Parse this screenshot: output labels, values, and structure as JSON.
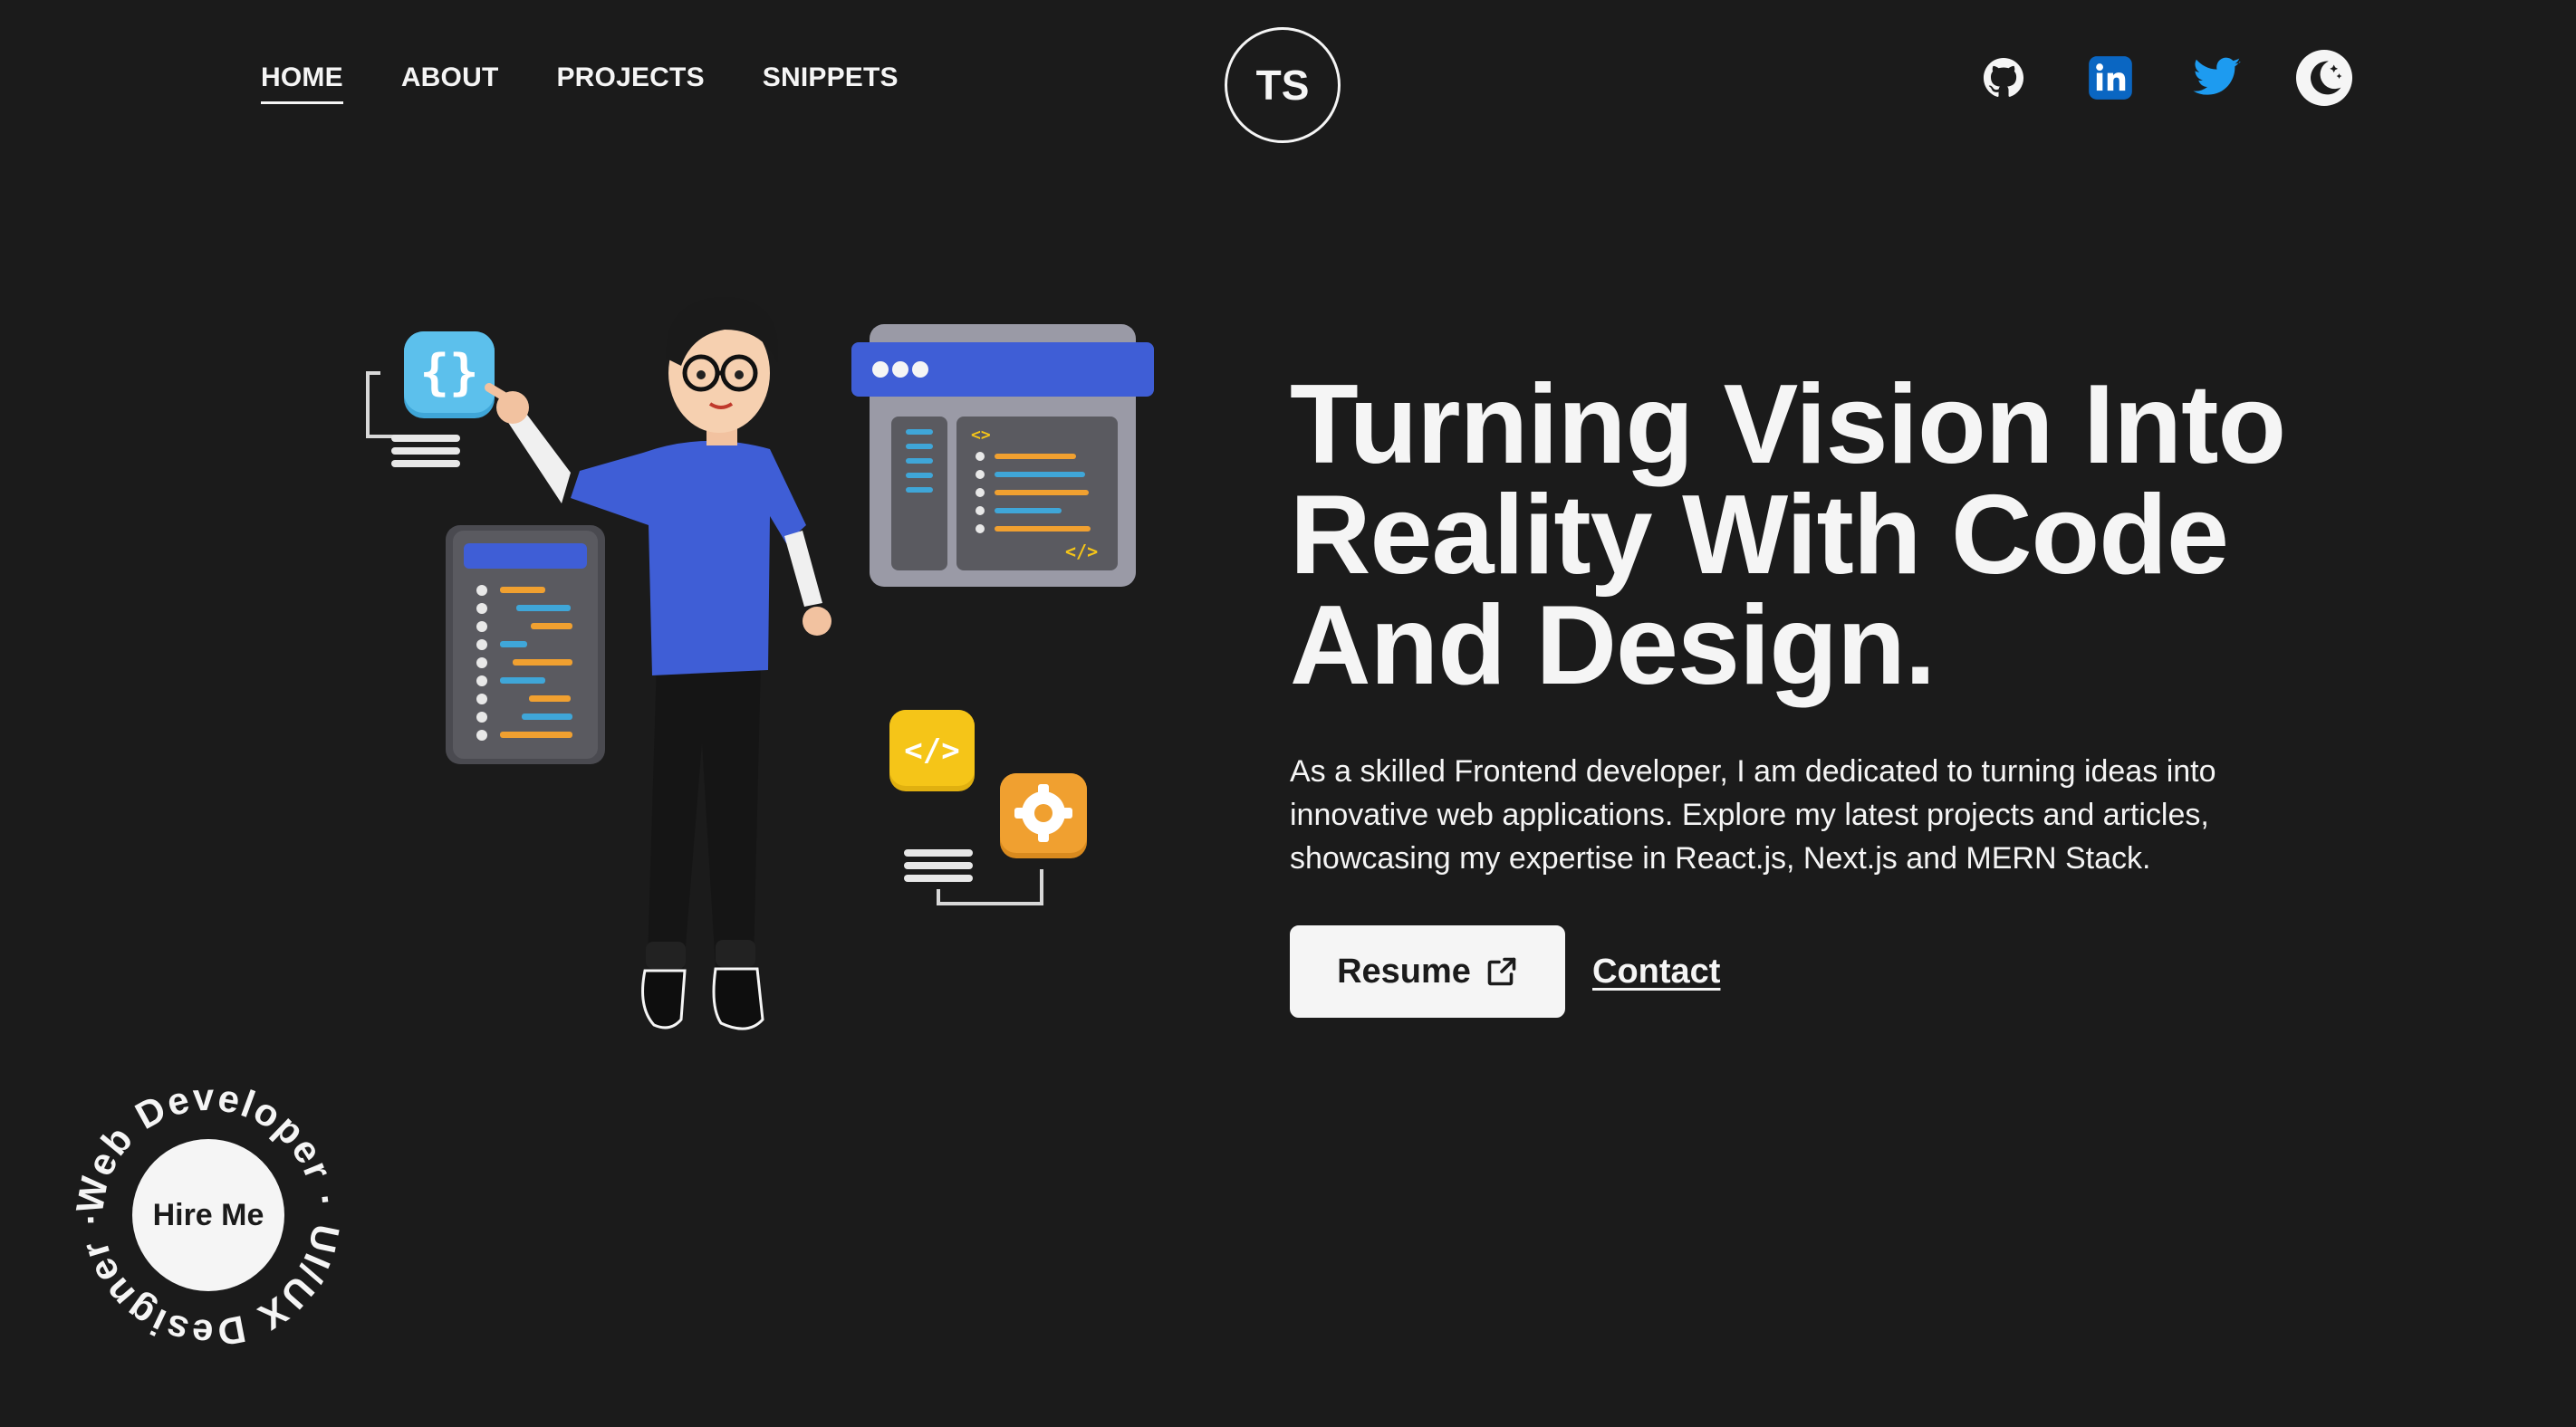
{
  "nav": {
    "links": [
      {
        "label": "HOME",
        "active": true
      },
      {
        "label": "ABOUT",
        "active": false
      },
      {
        "label": "PROJECTS",
        "active": false
      },
      {
        "label": "SNIPPETS",
        "active": false
      }
    ],
    "logo_text": "TS",
    "social": [
      "github-icon",
      "linkedin-icon",
      "twitter-icon",
      "theme-toggle-moon-icon"
    ]
  },
  "hero": {
    "title_lines": [
      "Turning Vision Into",
      "Reality With Code",
      "And Design."
    ],
    "description_lines": [
      "As a skilled Frontend developer, I am dedicated to turning ideas into",
      "innovative web applications. Explore my latest projects and articles,",
      "showcasing my expertise in React.js, Next.js and MERN Stack."
    ],
    "resume_label": "Resume",
    "contact_label": "Contact"
  },
  "hire": {
    "button_label": "Hire Me",
    "ring_text": "Web Developer · UI/UX Designer ·"
  },
  "colors": {
    "background": "#1b1b1b",
    "foreground": "#f5f5f5",
    "accent_blue": "#3f5ed6",
    "linkedin": "#0a66c2",
    "twitter": "#1d9bf0",
    "yellow": "#f5c518",
    "orange": "#f0a030"
  }
}
